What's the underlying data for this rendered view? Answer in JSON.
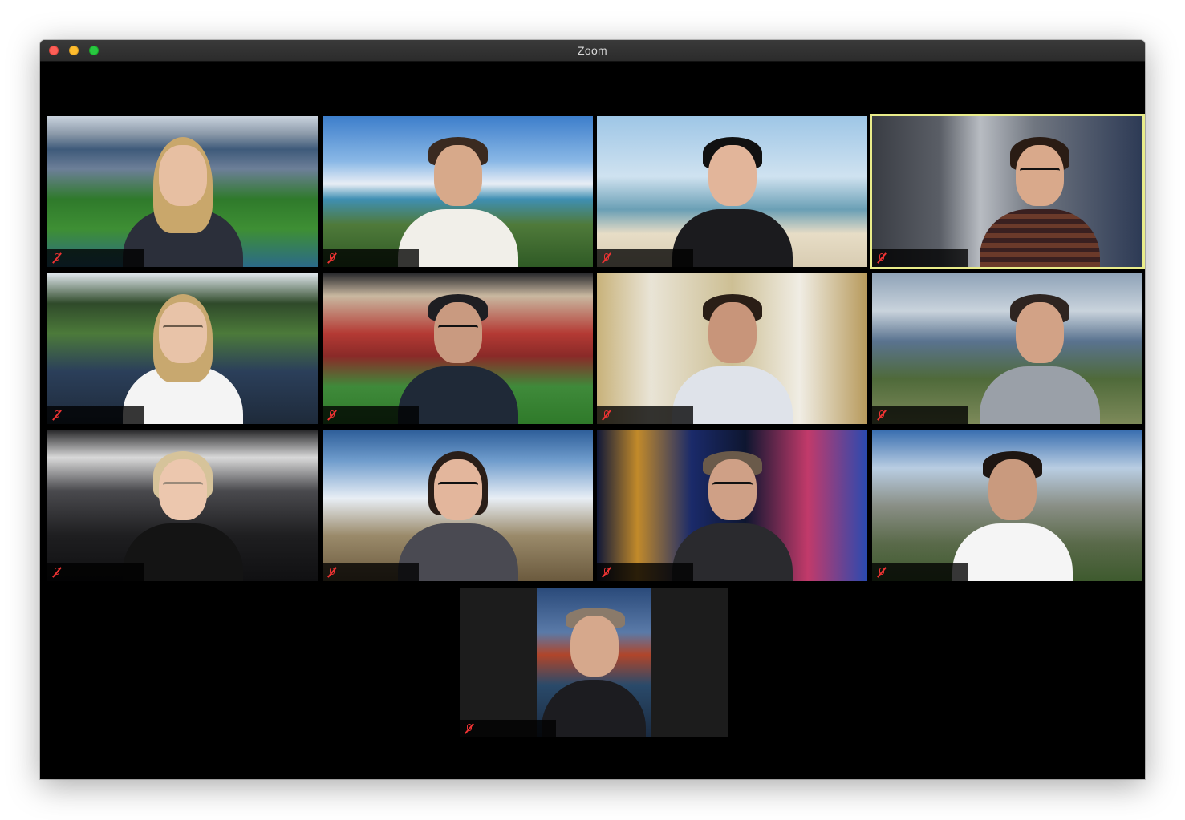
{
  "window": {
    "title": "Zoom",
    "traffic_lights": [
      "close",
      "minimize",
      "zoom"
    ]
  },
  "gallery": {
    "participants": [
      {
        "background": "stadium",
        "muted": true,
        "active_speaker": false
      },
      {
        "background": "island-coast",
        "muted": true,
        "active_speaker": false
      },
      {
        "background": "tropical-beach",
        "muted": true,
        "active_speaker": false
      },
      {
        "background": "sitcom-apartment",
        "muted": true,
        "active_speaker": true
      },
      {
        "background": "golf-course",
        "muted": true,
        "active_speaker": false
      },
      {
        "background": "football-stadium",
        "muted": true,
        "active_speaker": false
      },
      {
        "background": "oval-office",
        "muted": true,
        "active_speaker": false
      },
      {
        "background": "coastal-cliffs",
        "muted": true,
        "active_speaker": false
      },
      {
        "background": "boxing-gym",
        "muted": true,
        "active_speaker": false
      },
      {
        "background": "snowy-mountains",
        "muted": true,
        "active_speaker": false
      },
      {
        "background": "las-vegas-strip",
        "muted": true,
        "active_speaker": false
      },
      {
        "background": "mountain-city-view",
        "muted": true,
        "active_speaker": false
      },
      {
        "background": "golden-gate-bridge",
        "muted": true,
        "active_speaker": false
      }
    ]
  },
  "colors": {
    "active_speaker_border": "#e9ec8a",
    "muted_icon": "#ee3333",
    "window_bg": "#000000"
  }
}
